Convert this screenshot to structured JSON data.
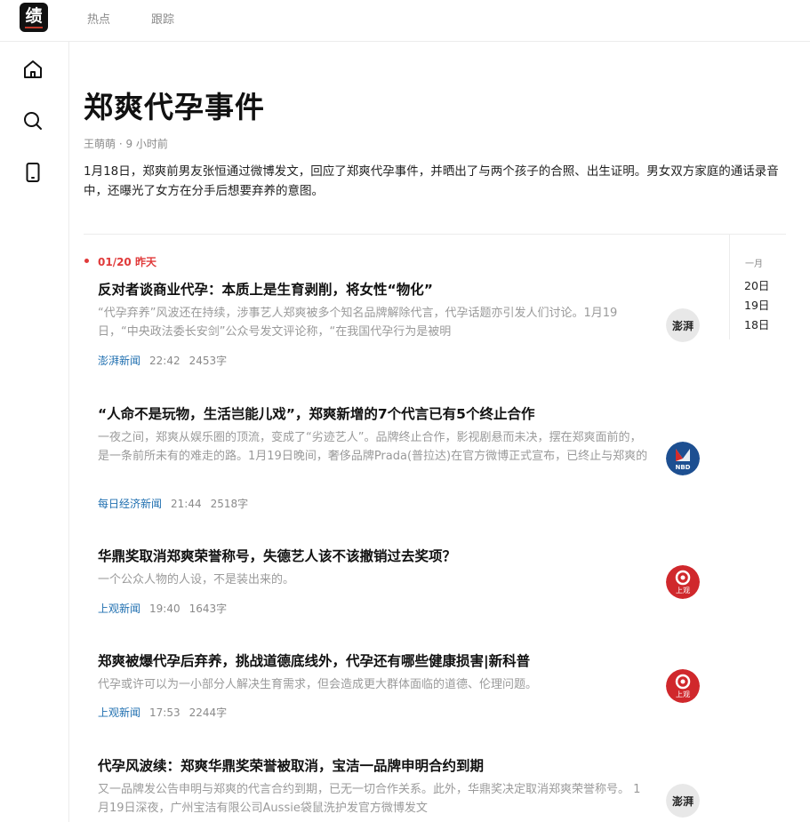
{
  "app": {
    "logo_glyph": "绩",
    "nav": {
      "hot": "热点",
      "follow": "跟踪"
    }
  },
  "rail_icons": [
    "home-icon",
    "search-icon",
    "phone-icon"
  ],
  "topic": {
    "title": "郑爽代孕事件",
    "meta": "王萌萌 · 9 小时前",
    "summary": "1月18日，郑爽前男友张恒通过微博发文，回应了郑爽代孕事件，并晒出了与两个孩子的合照、出生证明。男女双方家庭的通话录音中，还曝光了女方在分手后想要弃养的意图。"
  },
  "timeline": {
    "month": "一月",
    "days": [
      "20日",
      "19日",
      "18日"
    ],
    "current_date": "01/20  昨天"
  },
  "colors": {
    "accent_red": "#e03a3a",
    "source_blue": "#1f6fb0",
    "muted": "#9a9a9a"
  },
  "articles": [
    {
      "title": "反对者谈商业代孕：本质上是生育剥削，将女性“物化”",
      "desc": "“代孕弃养”风波还在持续，涉事艺人郑爽被多个知名品牌解除代言，代孕话题亦引发人们讨论。1月19日，“中央政法委长安剑”公众号发文评论称，“在我国代孕行为是被明",
      "source": "澎湃新闻",
      "time": "22:42",
      "words": "2453字",
      "avatar": "thepaper"
    },
    {
      "title": "“人命不是玩物，生活岂能儿戏”，郑爽新增的7个代言已有5个终止合作",
      "desc": "一夜之间，郑爽从娱乐圈的顶流，变成了“劣迹艺人”。品牌终止合作，影视剧悬而未决，摆在郑爽面前的，是一条前所未有的难走的路。1月19日晚间，奢侈品牌Prada(普拉达)在官方微博正式宣布，已终止与郑爽的",
      "source": "每日经济新闻",
      "time": "21:44",
      "words": "2518字",
      "avatar": "nbd"
    },
    {
      "title": "华鼎奖取消郑爽荣誉称号，失德艺人该不该撤销过去奖项？",
      "desc": "一个公众人物的人设，不是装出来的。",
      "source": "上观新闻",
      "time": "19:40",
      "words": "1643字",
      "avatar": "shanguan"
    },
    {
      "title": "郑爽被爆代孕后弃养，挑战道德底线外，代孕还有哪些健康损害|新科普",
      "desc": "代孕或许可以为一小部分人解决生育需求，但会造成更大群体面临的道德、伦理问题。",
      "source": "上观新闻",
      "time": "17:53",
      "words": "2244字",
      "avatar": "shanguan"
    },
    {
      "title": "代孕风波续：郑爽华鼎奖荣誉被取消，宝洁一品牌申明合约到期",
      "desc": "又一品牌发公告申明与郑爽的代言合约到期，已无一切合作关系。此外，华鼎奖决定取消郑爽荣誉称号。 1月19日深夜，广州宝洁有限公司Aussie袋鼠洗护发官方微博发文",
      "source": "",
      "time": "",
      "words": "",
      "avatar": "thepaper"
    }
  ],
  "avatar_labels": {
    "thepaper": "澎湃",
    "nbd": "NBD",
    "shanguan": "上观"
  }
}
